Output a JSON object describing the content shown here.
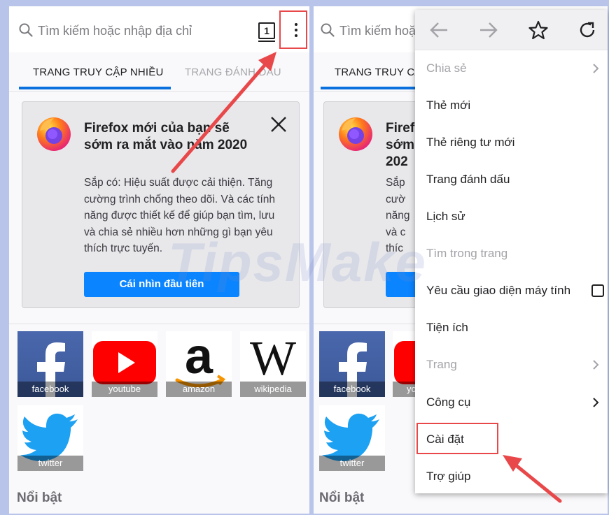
{
  "left": {
    "search_placeholder": "Tìm kiếm hoặc nhập địa chỉ",
    "tab_count": "1",
    "tabs": [
      "TRANG TRUY CẬP NHIỀU",
      "TRANG ĐÁNH DẤU"
    ],
    "card": {
      "title": "Firefox mới của bạn sẽ sớm ra mắt vào năm 2020",
      "body": "Sắp có: Hiệu suất được cải thiện. Tăng cường trình chống theo dõi. Và các tính năng được thiết kế để giúp bạn tìm, lưu và chia sẻ nhiều hơn những gì bạn yêu thích trực tuyến.",
      "button": "Cái nhìn đầu tiên"
    },
    "top_sites": [
      "facebook",
      "youtube",
      "amazon",
      "wikipedia",
      "twitter"
    ],
    "section_title": "Nổi bật"
  },
  "right": {
    "search_placeholder": "Tìm kiếm hoặ",
    "tab_label": "TRANG TRUY CẬ",
    "card_title_lines": [
      "Firef",
      "sớm",
      "202"
    ],
    "card_body_lines": [
      "Sắp",
      "cườ",
      "năng",
      "và c",
      "thíc"
    ],
    "top_sites": [
      "facebook",
      "yo",
      "twitter"
    ],
    "section_title": "Nổi bật"
  },
  "menu": {
    "icons": [
      "back-arrow-icon",
      "forward-arrow-icon",
      "star-icon",
      "reload-icon"
    ],
    "items": [
      {
        "label": "Chia sẻ",
        "disabled": true,
        "chevron": true
      },
      {
        "label": "Thẻ mới",
        "disabled": false
      },
      {
        "label": "Thẻ riêng tư mới",
        "disabled": false
      },
      {
        "label": "Trang đánh dấu",
        "disabled": false
      },
      {
        "label": "Lịch sử",
        "disabled": false
      },
      {
        "label": "Tìm trong trang",
        "disabled": true
      },
      {
        "label": "Yêu cầu giao diện máy tính",
        "disabled": false,
        "checkbox": true
      },
      {
        "label": "Tiện ích",
        "disabled": false
      },
      {
        "label": "Trang",
        "disabled": true,
        "chevron": true
      },
      {
        "label": "Công cụ",
        "disabled": false,
        "chevron": true
      },
      {
        "label": "Cài đặt",
        "disabled": false
      },
      {
        "label": "Trợ giúp",
        "disabled": false
      }
    ]
  },
  "watermark": "TipsMake",
  "colors": {
    "accent": "#0a84ff",
    "tab_underline": "#0a70de",
    "highlight": "#e8484a",
    "background": "#b9c4ea"
  }
}
